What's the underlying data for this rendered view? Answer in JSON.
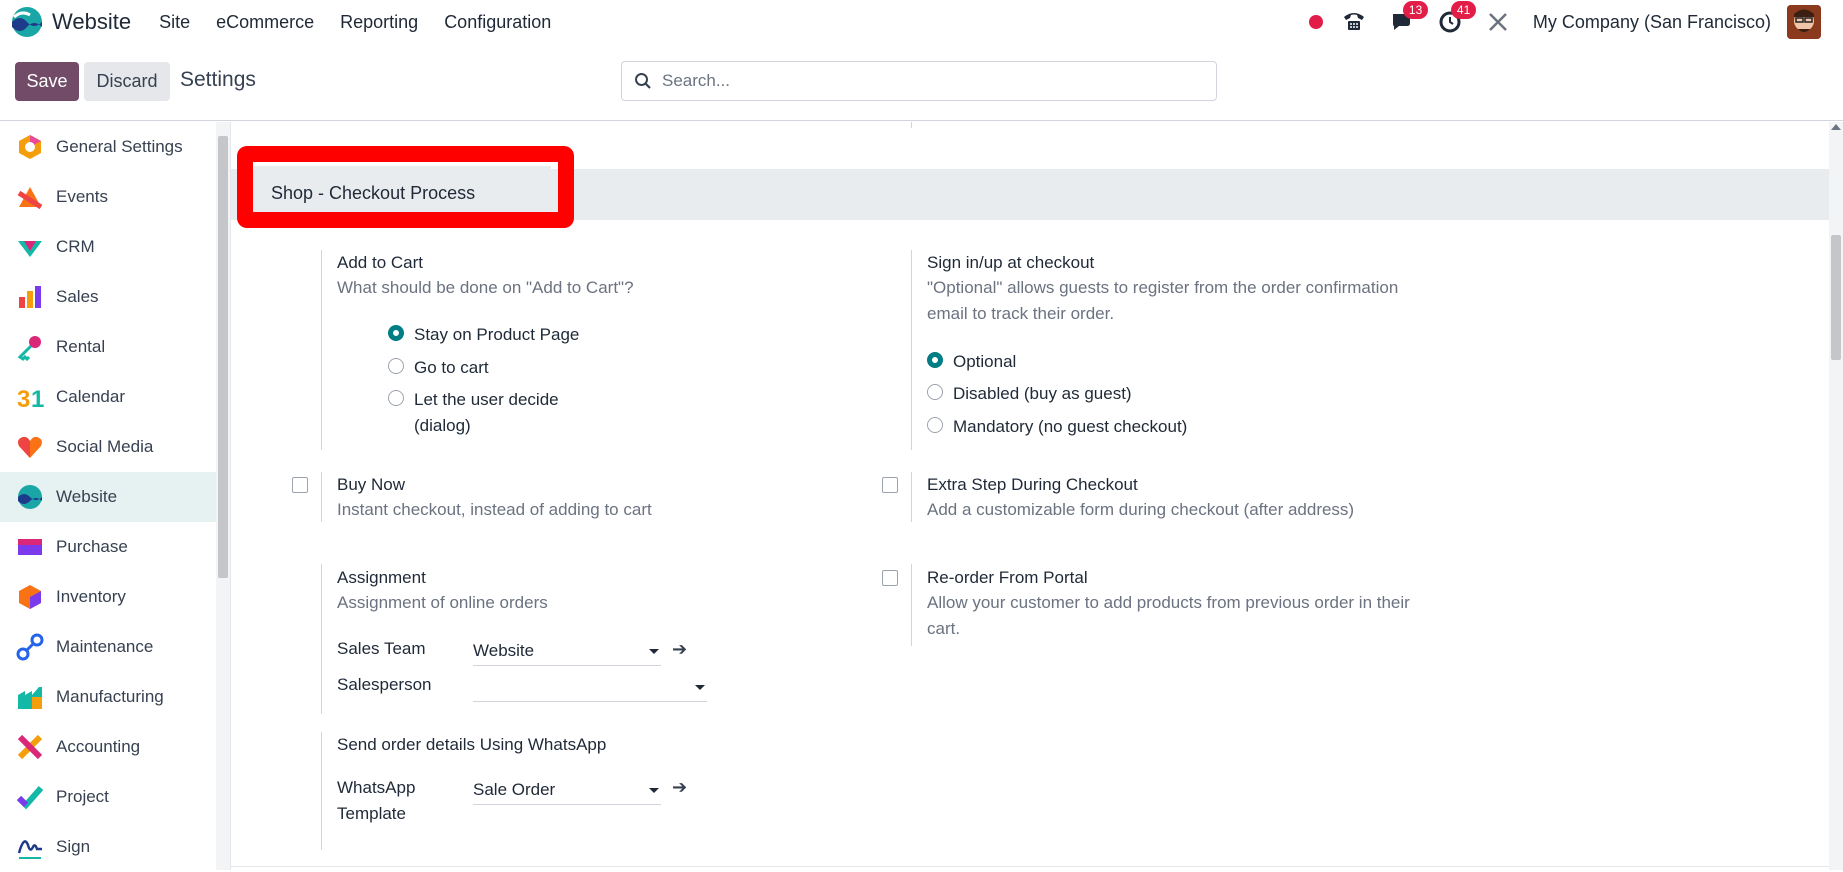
{
  "navbar": {
    "app_name": "Website",
    "menu": [
      "Site",
      "eCommerce",
      "Reporting",
      "Configuration"
    ],
    "messages_count": "13",
    "activities_count": "41",
    "company": "My Company (San Francisco)",
    "icons": [
      "record-dot-icon",
      "phone-icon",
      "chat-icon",
      "clock-icon",
      "tools-icon"
    ]
  },
  "control": {
    "save_label": "Save",
    "discard_label": "Discard",
    "title": "Settings",
    "search_placeholder": "Search..."
  },
  "sidebar": {
    "items": [
      {
        "label": "General Settings",
        "icon": "general-settings-icon"
      },
      {
        "label": "Events",
        "icon": "events-icon"
      },
      {
        "label": "CRM",
        "icon": "crm-icon"
      },
      {
        "label": "Sales",
        "icon": "sales-icon"
      },
      {
        "label": "Rental",
        "icon": "rental-icon"
      },
      {
        "label": "Calendar",
        "icon": "calendar-icon"
      },
      {
        "label": "Social Media",
        "icon": "social-media-icon"
      },
      {
        "label": "Website",
        "icon": "website-icon",
        "active": true
      },
      {
        "label": "Purchase",
        "icon": "purchase-icon"
      },
      {
        "label": "Inventory",
        "icon": "inventory-icon"
      },
      {
        "label": "Maintenance",
        "icon": "maintenance-icon"
      },
      {
        "label": "Manufacturing",
        "icon": "manufacturing-icon"
      },
      {
        "label": "Accounting",
        "icon": "accounting-icon"
      },
      {
        "label": "Project",
        "icon": "project-icon"
      },
      {
        "label": "Sign",
        "icon": "sign-icon"
      }
    ]
  },
  "section": {
    "title": "Shop - Checkout Process"
  },
  "add_to_cart": {
    "title": "Add to Cart",
    "desc": "What should be done on \"Add to Cart\"?",
    "options": [
      "Stay on Product Page",
      "Go to cart",
      "Let the user decide",
      "(dialog)"
    ],
    "selected": "Stay on Product Page"
  },
  "sign_in": {
    "title": "Sign in/up at checkout",
    "desc_line1": "\"Optional\" allows guests to register from the order confirmation",
    "desc_line2": "email to track their order.",
    "options": [
      "Optional",
      "Disabled (buy as guest)",
      "Mandatory (no guest checkout)"
    ],
    "selected": "Optional"
  },
  "buy_now": {
    "title": "Buy Now",
    "desc": "Instant checkout, instead of adding to cart",
    "checked": false
  },
  "extra_step": {
    "title": "Extra Step During Checkout",
    "desc": "Add a customizable form during checkout (after address)",
    "checked": false
  },
  "assignment": {
    "title": "Assignment",
    "desc": "Assignment of online orders",
    "sales_team_label": "Sales Team",
    "sales_team_value": "Website",
    "salesperson_label": "Salesperson",
    "salesperson_value": ""
  },
  "reorder": {
    "title": "Re-order From Portal",
    "desc_line1": "Allow your customer to add products from previous order in their",
    "desc_line2": "cart.",
    "checked": false
  },
  "whatsapp": {
    "title": "Send order details Using WhatsApp",
    "template_label_line1": "WhatsApp",
    "template_label_line2": "Template",
    "template_value": "Sale Order"
  },
  "colors": {
    "brand": "#714b67",
    "accent": "#017e84",
    "highlight": "#ff0000",
    "badge": "#e11d48"
  }
}
